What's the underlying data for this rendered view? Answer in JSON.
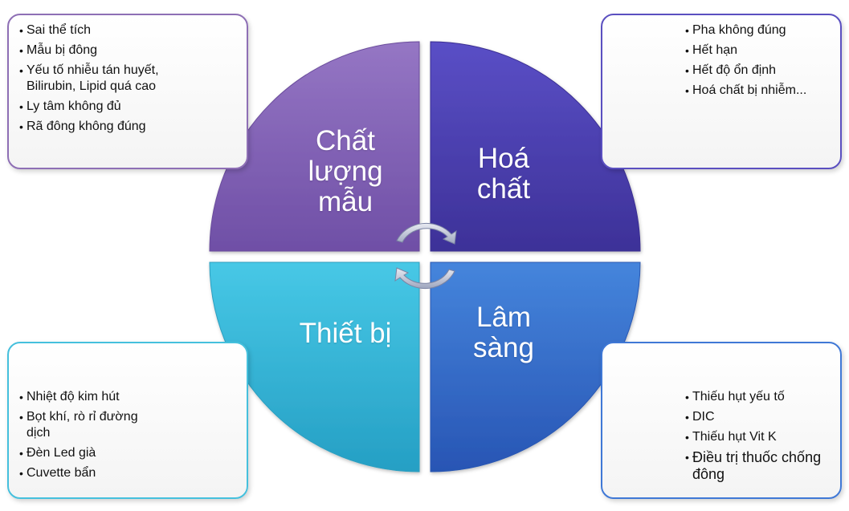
{
  "quadrants": {
    "top_left": {
      "label": "Chất\nlượng\nmẫu",
      "color": "#7f5fb0",
      "items": [
        "Sai thể tích",
        "Mẫu bị đông",
        "Yếu tố nhiễu tán huyết, Bilirubin, Lipid quá cao",
        "Ly tâm không đủ",
        "Rã đông không đúng"
      ]
    },
    "top_right": {
      "label": "Hoá\nchất",
      "color": "#4a3fae",
      "items": [
        "Pha không đúng",
        "Hết hạn",
        "Hết độ ổn định",
        "Hoá chất bị nhiễm..."
      ]
    },
    "bottom_left": {
      "label": "Thiết bị",
      "color": "#35b7d8",
      "items": [
        "Nhiệt độ kim hút",
        "Bọt khí, rò rỉ đường dịch",
        "Đèn Led già",
        "Cuvette bẩn"
      ]
    },
    "bottom_right": {
      "label": "Lâm\nsàng",
      "color": "#356cd0",
      "items": [
        "Thiếu hụt yếu tố",
        "DIC",
        "Thiếu hụt Vit K",
        "Điều trị thuốc chống đông"
      ]
    }
  },
  "center_icon": "cycle-arrows-icon"
}
